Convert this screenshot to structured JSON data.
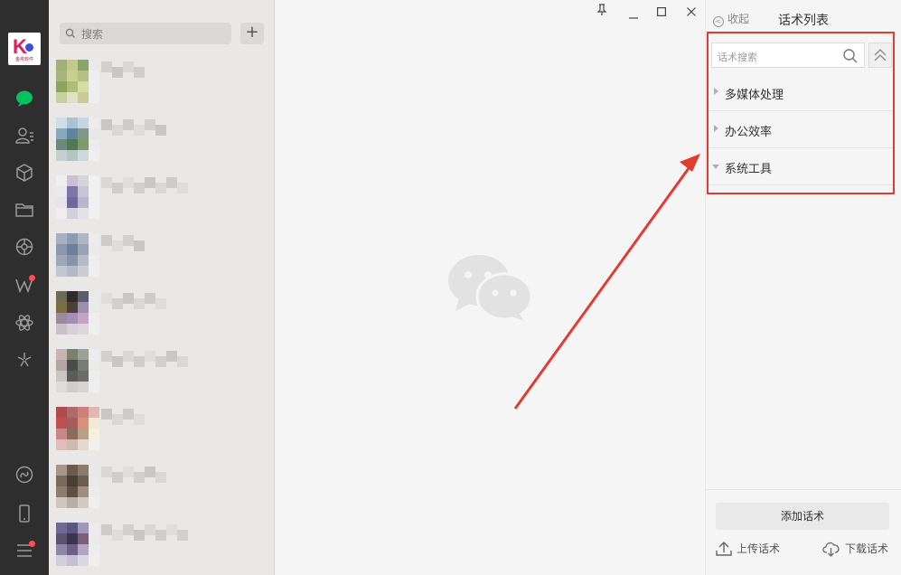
{
  "app": {
    "logo_text": "金舟软件"
  },
  "nav": {
    "icons": [
      "chat-icon",
      "contacts-icon",
      "box-icon",
      "folder-icon",
      "moments-icon",
      "w-app-icon",
      "atom-icon",
      "sparkle-icon",
      "miniprogram-icon",
      "phone-icon",
      "menu-icon"
    ],
    "badges": [
      "w-app-icon",
      "menu-icon"
    ],
    "accent": "#07c160",
    "badge_color": "#fa5151"
  },
  "chatlist": {
    "search_placeholder": "搜索",
    "add_label": "+",
    "rows": [
      {
        "av": [
          "#9fb07a",
          "#c2c88e",
          "#8aa56a",
          "#e9e9e9",
          "#a8b47c",
          "#c7d18f",
          "#b6c082",
          "#eeeeee",
          "#8ea35e",
          "#aebe78",
          "#d5dca4",
          "#efefef",
          "#c9d0a0",
          "#dfe3c2",
          "#c5cc96",
          "#eeeeee"
        ]
      },
      {
        "av": [
          "#d0dde5",
          "#a9c3d3",
          "#c6d6e2",
          "#ececec",
          "#88a8bc",
          "#5d84a0",
          "#7e9a87",
          "#e8e8e8",
          "#6b8a7c",
          "#4f7a55",
          "#7f9a6a",
          "#ececec",
          "#c4cfd4",
          "#b6c4c0",
          "#cfd8da",
          "#efefef"
        ]
      },
      {
        "av": [
          "#f0eef1",
          "#c9c1cf",
          "#d7d3dc",
          "#f0f0f0",
          "#ebe8ed",
          "#7c77a8",
          "#c8c4d6",
          "#f0f0f0",
          "#e6e3ea",
          "#6e6a9b",
          "#b9b5cc",
          "#f0f0f0",
          "#efedf0",
          "#d3d0d9",
          "#e4e2e7",
          "#f0f0f0"
        ]
      },
      {
        "av": [
          "#a7b1c2",
          "#8f9bb0",
          "#b0b7c4",
          "#ececec",
          "#8a97ad",
          "#6f7f9a",
          "#9aa3b6",
          "#ebebeb",
          "#9ea7b8",
          "#8893a7",
          "#b5bcc8",
          "#eeeeee",
          "#c1c6cf",
          "#b3bac5",
          "#c9cdd4",
          "#efefef"
        ]
      },
      {
        "av": [
          "#6e6a55",
          "#2f2b2a",
          "#5d5c6c",
          "#e9e9e9",
          "#7d6d3e",
          "#4b4035",
          "#9b8fb0",
          "#eaeaea",
          "#9a8a9d",
          "#a38fb3",
          "#c4a3c7",
          "#eeeeee",
          "#c8c1c8",
          "#d8cfd8",
          "#dcd6de",
          "#efefef"
        ]
      },
      {
        "av": [
          "#c7b4b3",
          "#7c8070",
          "#9ca095",
          "#ececec",
          "#b2a7a3",
          "#4a4c48",
          "#7a7d76",
          "#ebebeb",
          "#c9c7c4",
          "#5c5d59",
          "#6b6c68",
          "#ededed",
          "#dedcdb",
          "#cfcecc",
          "#d6d5d3",
          "#efefef"
        ]
      },
      {
        "av": [
          "#b04a4e",
          "#b06a6c",
          "#d0807b",
          "#e3b6b3",
          "#c0504f",
          "#a65c5a",
          "#d98f7c",
          "#f3ead1",
          "#c8868a",
          "#8e6a5a",
          "#b6a088",
          "#f6f0dc",
          "#e2bbbb",
          "#d0b9ae",
          "#e5d9cc",
          "#f2f0ea"
        ]
      },
      {
        "av": [
          "#a8968a",
          "#6b5b4f",
          "#8c7a6d",
          "#e8e8e8",
          "#7b6a5c",
          "#4a3d33",
          "#6d5d50",
          "#e9e9e9",
          "#8c7b6e",
          "#5d4f45",
          "#a08d7f",
          "#ececec",
          "#cfc6bf",
          "#b9ada4",
          "#d2c9c2",
          "#efefef"
        ]
      },
      {
        "av": [
          "#6f6a94",
          "#5d547f",
          "#9e96bd",
          "#ececec",
          "#5b5274",
          "#3b3450",
          "#7d5f7b",
          "#ebebeb",
          "#8d86a6",
          "#6d5f88",
          "#b3a6c4",
          "#ededed",
          "#d2cedb",
          "#c6bfd3",
          "#dcd8e2",
          "#efefef"
        ]
      }
    ]
  },
  "main": {
    "window_buttons": [
      "pin-icon",
      "minimize-icon",
      "maximize-icon",
      "close-icon"
    ]
  },
  "panel": {
    "collapse_label": "收起",
    "title": "话术列表",
    "search_placeholder": "话术搜索",
    "categories": [
      {
        "label": "多媒体处理",
        "expanded": false
      },
      {
        "label": "办公效率",
        "expanded": false
      },
      {
        "label": "系统工具",
        "expanded": true
      }
    ],
    "add_button": "添加话术",
    "upload_label": "上传话术",
    "download_label": "下载话术",
    "highlight_color": "#e03c31"
  }
}
